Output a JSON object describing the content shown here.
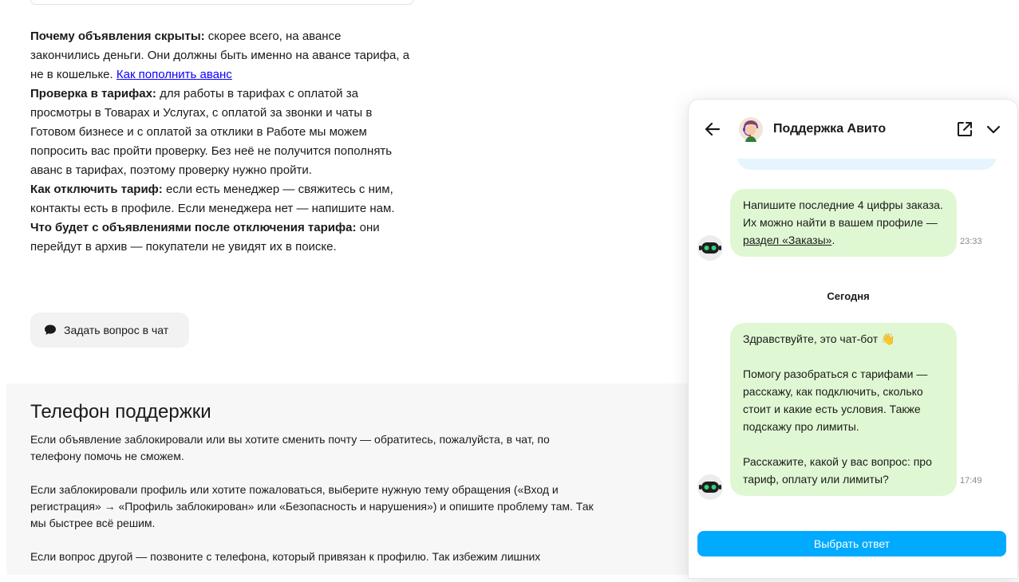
{
  "faq": {
    "items": [
      {
        "title": "Почему объявления скрыты:",
        "text": " скорее всего, на авансе закончились деньги. Они должны быть именно на авансе тарифа, а не в кошельке. ",
        "link": "Как пополнить аванс"
      },
      {
        "title": "Проверка в тарифах:",
        "text": " для работы в тарифах с оплатой за просмотры в Товарах и Услугах, с оплатой за звонки и чаты в Готовом бизнесе и с оплатой за отклики в Работе мы можем попросить вас пройти проверку. Без неё не получится пополнять аванс в тарифах, поэтому проверку нужно пройти."
      },
      {
        "title": "Как отключить тариф:",
        "text": " если есть менеджер — свяжитесь с ним, контакты есть в профиле. Если менеджера нет — напишите нам."
      },
      {
        "title": "Что будет с объявлениями после отключения тарифа:",
        "text": " они перейдут в архив — покупатели не увидят их в поиске."
      }
    ]
  },
  "ask_button": {
    "label": "Задать вопрос в чат",
    "icon": "chat-bubble-icon"
  },
  "phone": {
    "title": "Телефон поддержки",
    "paragraphs": [
      "Если объявление заблокировали или вы хотите сменить почту — обратитесь, пожалуйста, в чат, по телефону помочь не сможем.",
      "Если заблокировали профиль или хотите пожаловаться, выберите нужную тему обращения («Вход и регистрация» → «Профиль заблокирован» или «Безопасность и нарушения») и опишите проблему там. Так мы быстрее всё решим.",
      "Если вопрос другой — позвоните с телефона, который привязан к профилю. Так избежим лишних"
    ]
  },
  "chat": {
    "title": "Поддержка Авито",
    "messages": [
      {
        "text": "Напишите последние 4 цифры заказа. Их можно найти в вашем профиле — ",
        "link": "раздел «Заказы»",
        "after": ".",
        "time": "23:33"
      }
    ],
    "day_label": "Сегодня",
    "bot_message": {
      "greeting": "Здравствуйте, это чат-бот 👋",
      "p1": "Помогу разобраться с тарифами — расскажу, как подключить, сколько стоит и какие есть условия. Также подскажу про лимиты.",
      "p2": "Расскажите, какой у вас вопрос: про тариф, оплату или лимиты?",
      "time": "17:49"
    },
    "choose_button": "Выбрать ответ",
    "colors": {
      "bot_bubble": "#dff8d3",
      "user_bubble": "#e6f4fd",
      "accent": "#00aaff"
    }
  }
}
